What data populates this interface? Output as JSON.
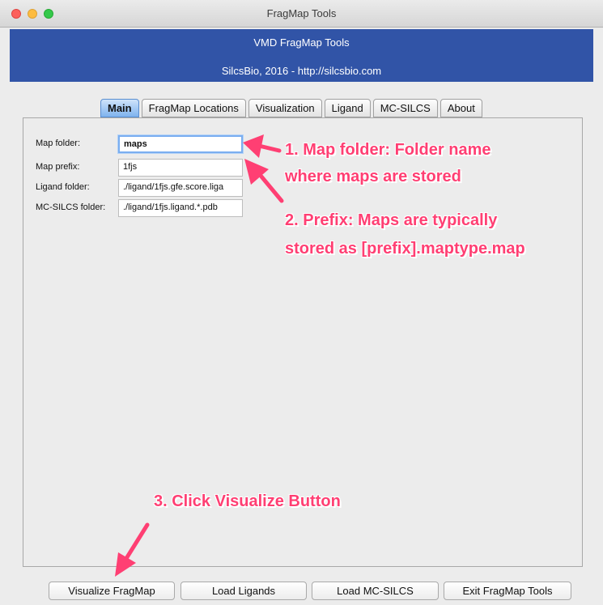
{
  "window": {
    "title": "FragMap Tools"
  },
  "banner": {
    "line1": "VMD FragMap Tools",
    "line2": "SilcsBio, 2016 - http://silcsbio.com"
  },
  "tabs": [
    {
      "label": "Main",
      "active": true
    },
    {
      "label": "FragMap Locations",
      "active": false
    },
    {
      "label": "Visualization",
      "active": false
    },
    {
      "label": "Ligand",
      "active": false
    },
    {
      "label": "MC-SILCS",
      "active": false
    },
    {
      "label": "About",
      "active": false
    }
  ],
  "form": {
    "map_folder": {
      "label": "Map folder:",
      "value": "maps"
    },
    "map_prefix": {
      "label": "Map prefix:",
      "value": "1fjs"
    },
    "ligand_folder": {
      "label": "Ligand folder:",
      "value": "./ligand/1fjs.gfe.score.liga"
    },
    "mcsilcs_folder": {
      "label": "MC-SILCS folder:",
      "value": "./ligand/1fjs.ligand.*.pdb"
    }
  },
  "annotations": {
    "a1_line1": "1. Map folder: Folder name",
    "a1_line2": "where maps are stored",
    "a2_line1": "2. Prefix: Maps are typically",
    "a2_line2": "stored as [prefix].maptype.map",
    "a3": "3. Click Visualize Button",
    "color": "#ff3f73"
  },
  "buttons": {
    "visualize": "Visualize FragMap",
    "load_ligands": "Load Ligands",
    "load_mcsilcs": "Load MC-SILCS",
    "exit": "Exit FragMap Tools"
  }
}
